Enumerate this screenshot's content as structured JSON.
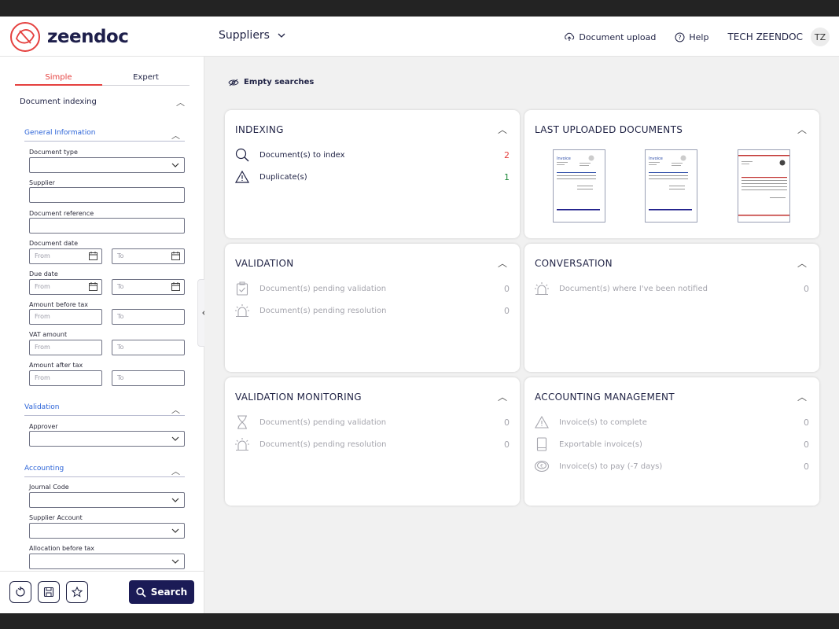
{
  "header": {
    "brand": "zeendoc",
    "nav_label": "Suppliers",
    "upload_label": "Document upload",
    "help_label": "Help",
    "user_name": "TECH ZEENDOC",
    "avatar_initials": "TZ"
  },
  "sidebar": {
    "tabs": [
      "Simple",
      "Expert"
    ],
    "active_tab": "Simple",
    "section_title": "Document indexing",
    "groups": {
      "general": "General Information",
      "validation": "Validation",
      "accounting": "Accounting"
    },
    "labels": {
      "document_type": "Document type",
      "supplier": "Supplier",
      "document_reference": "Document reference",
      "document_date": "Document date",
      "due_date": "Due date",
      "amount_before_tax": "Amount before tax",
      "vat_amount": "VAT amount",
      "amount_after_tax": "Amount after tax",
      "approver": "Approver",
      "journal_code": "Journal Code",
      "supplier_account": "Supplier Account",
      "allocation_before_tax": "Allocation before tax"
    },
    "placeholders": {
      "from": "From",
      "to": "To"
    },
    "search_label": "Search"
  },
  "main": {
    "empty_searches": "Empty searches",
    "cards": {
      "indexing": {
        "title": "INDEXING",
        "rows": [
          {
            "label": "Document(s) to index",
            "count": "2"
          },
          {
            "label": "Duplicate(s)",
            "count": "1"
          }
        ]
      },
      "last_uploaded": {
        "title": "LAST UPLOADED DOCUMENTS"
      },
      "validation": {
        "title": "VALIDATION",
        "rows": [
          {
            "label": "Document(s) pending validation",
            "count": "0"
          },
          {
            "label": "Document(s) pending resolution",
            "count": "0"
          }
        ]
      },
      "conversation": {
        "title": "CONVERSATION",
        "rows": [
          {
            "label": "Document(s) where I've been notified",
            "count": "0"
          }
        ]
      },
      "validation_monitoring": {
        "title": "VALIDATION MONITORING",
        "rows": [
          {
            "label": "Document(s) pending validation",
            "count": "0"
          },
          {
            "label": "Document(s) pending resolution",
            "count": "0"
          }
        ]
      },
      "accounting_management": {
        "title": "ACCOUNTING MANAGEMENT",
        "rows": [
          {
            "label": "Invoice(s) to complete",
            "count": "0"
          },
          {
            "label": "Exportable invoice(s)",
            "count": "0"
          },
          {
            "label": "Invoice(s) to pay (-7 days)",
            "count": "0"
          }
        ]
      }
    }
  },
  "colors": {
    "accent_red": "#e5413f",
    "navy": "#1b1b56",
    "link_blue": "#2c64d8",
    "success_green": "#1f8a3a"
  }
}
